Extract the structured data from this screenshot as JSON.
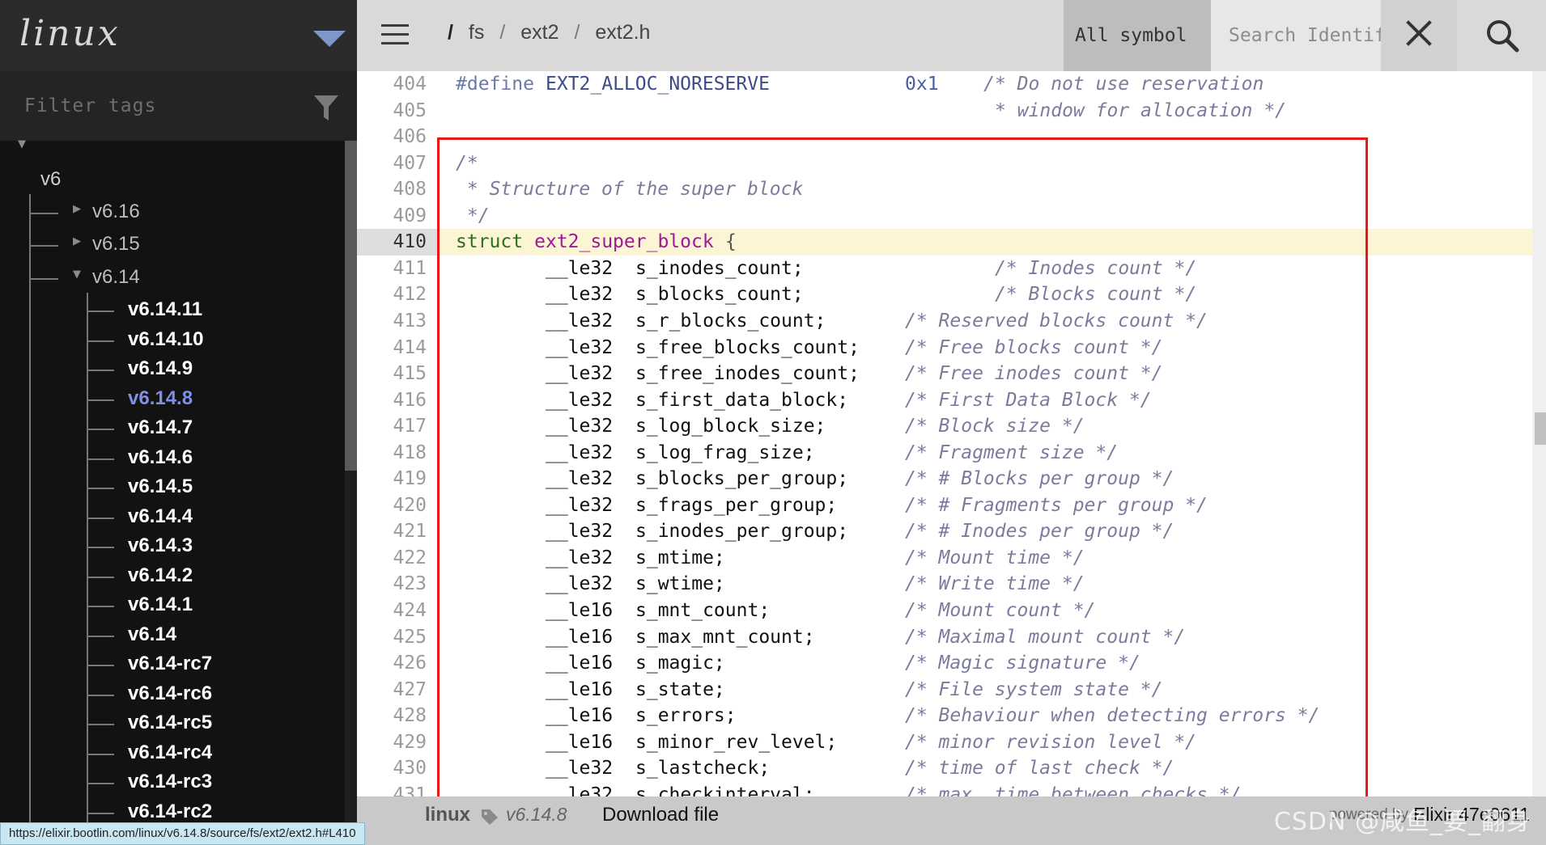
{
  "project": {
    "name": "linux",
    "filter_placeholder": "Filter tags"
  },
  "tree": {
    "root": "v6",
    "branches": [
      {
        "label": "v6.16",
        "expanded": false
      },
      {
        "label": "v6.15",
        "expanded": false
      },
      {
        "label": "v6.14",
        "expanded": true
      }
    ],
    "leaves": [
      "v6.14.11",
      "v6.14.10",
      "v6.14.9",
      "v6.14.8",
      "v6.14.7",
      "v6.14.6",
      "v6.14.5",
      "v6.14.4",
      "v6.14.3",
      "v6.14.2",
      "v6.14.1",
      "v6.14",
      "v6.14-rc7",
      "v6.14-rc6",
      "v6.14-rc5",
      "v6.14-rc4",
      "v6.14-rc3",
      "v6.14-rc2"
    ],
    "active_leaf": "v6.14.8"
  },
  "topbar": {
    "breadcrumb_root": "/",
    "breadcrumb": [
      "fs",
      "ext2",
      "ext2.h"
    ],
    "breadcrumb_sep": "/",
    "symbol_select": "All symbol",
    "search_placeholder": "Search Identifier"
  },
  "code": {
    "highlight_line": "410",
    "lines": [
      {
        "n": "404",
        "parts": [
          {
            "c": "t-pp",
            "col": 0,
            "t": "#define "
          },
          {
            "c": "t-name",
            "col": 8,
            "t": "EXT2_ALLOC_NORESERVE"
          },
          {
            "c": "t-num",
            "col": 40,
            "t": "0x1"
          },
          {
            "c": "t-cmt",
            "col": 47,
            "t": "/* Do not use reservation"
          }
        ]
      },
      {
        "n": "405",
        "parts": [
          {
            "c": "t-cmt",
            "col": 48,
            "t": "* window for allocation */"
          }
        ]
      },
      {
        "n": "406",
        "parts": []
      },
      {
        "n": "407",
        "parts": [
          {
            "c": "t-cmt",
            "col": 0,
            "t": "/*"
          }
        ]
      },
      {
        "n": "408",
        "parts": [
          {
            "c": "t-cmt",
            "col": 1,
            "t": "* Structure of the super block"
          }
        ]
      },
      {
        "n": "409",
        "parts": [
          {
            "c": "t-cmt",
            "col": 1,
            "t": "*/"
          }
        ]
      },
      {
        "n": "410",
        "parts": [
          {
            "c": "t-kw",
            "col": 0,
            "t": "struct "
          },
          {
            "c": "t-sym",
            "col": 7,
            "t": "ext2_super_block"
          },
          {
            "c": "t-punct",
            "col": 24,
            "t": "{"
          }
        ]
      },
      {
        "n": "411",
        "parts": [
          {
            "c": "t-type",
            "col": 8,
            "t": "__le32"
          },
          {
            "c": "t-ident",
            "col": 16,
            "t": "s_inodes_count;"
          },
          {
            "c": "t-cmt",
            "col": 48,
            "t": "/* Inodes count */"
          }
        ]
      },
      {
        "n": "412",
        "parts": [
          {
            "c": "t-type",
            "col": 8,
            "t": "__le32"
          },
          {
            "c": "t-ident",
            "col": 16,
            "t": "s_blocks_count;"
          },
          {
            "c": "t-cmt",
            "col": 48,
            "t": "/* Blocks count */"
          }
        ]
      },
      {
        "n": "413",
        "parts": [
          {
            "c": "t-type",
            "col": 8,
            "t": "__le32"
          },
          {
            "c": "t-ident",
            "col": 16,
            "t": "s_r_blocks_count;"
          },
          {
            "c": "t-cmt",
            "col": 40,
            "t": "/* Reserved blocks count */"
          }
        ]
      },
      {
        "n": "414",
        "parts": [
          {
            "c": "t-type",
            "col": 8,
            "t": "__le32"
          },
          {
            "c": "t-ident",
            "col": 16,
            "t": "s_free_blocks_count;"
          },
          {
            "c": "t-cmt",
            "col": 40,
            "t": "/* Free blocks count */"
          }
        ]
      },
      {
        "n": "415",
        "parts": [
          {
            "c": "t-type",
            "col": 8,
            "t": "__le32"
          },
          {
            "c": "t-ident",
            "col": 16,
            "t": "s_free_inodes_count;"
          },
          {
            "c": "t-cmt",
            "col": 40,
            "t": "/* Free inodes count */"
          }
        ]
      },
      {
        "n": "416",
        "parts": [
          {
            "c": "t-type",
            "col": 8,
            "t": "__le32"
          },
          {
            "c": "t-ident",
            "col": 16,
            "t": "s_first_data_block;"
          },
          {
            "c": "t-cmt",
            "col": 40,
            "t": "/* First Data Block */"
          }
        ]
      },
      {
        "n": "417",
        "parts": [
          {
            "c": "t-type",
            "col": 8,
            "t": "__le32"
          },
          {
            "c": "t-ident",
            "col": 16,
            "t": "s_log_block_size;"
          },
          {
            "c": "t-cmt",
            "col": 40,
            "t": "/* Block size */"
          }
        ]
      },
      {
        "n": "418",
        "parts": [
          {
            "c": "t-type",
            "col": 8,
            "t": "__le32"
          },
          {
            "c": "t-ident",
            "col": 16,
            "t": "s_log_frag_size;"
          },
          {
            "c": "t-cmt",
            "col": 40,
            "t": "/* Fragment size */"
          }
        ]
      },
      {
        "n": "419",
        "parts": [
          {
            "c": "t-type",
            "col": 8,
            "t": "__le32"
          },
          {
            "c": "t-ident",
            "col": 16,
            "t": "s_blocks_per_group;"
          },
          {
            "c": "t-cmt",
            "col": 40,
            "t": "/* # Blocks per group */"
          }
        ]
      },
      {
        "n": "420",
        "parts": [
          {
            "c": "t-type",
            "col": 8,
            "t": "__le32"
          },
          {
            "c": "t-ident",
            "col": 16,
            "t": "s_frags_per_group;"
          },
          {
            "c": "t-cmt",
            "col": 40,
            "t": "/* # Fragments per group */"
          }
        ]
      },
      {
        "n": "421",
        "parts": [
          {
            "c": "t-type",
            "col": 8,
            "t": "__le32"
          },
          {
            "c": "t-ident",
            "col": 16,
            "t": "s_inodes_per_group;"
          },
          {
            "c": "t-cmt",
            "col": 40,
            "t": "/* # Inodes per group */"
          }
        ]
      },
      {
        "n": "422",
        "parts": [
          {
            "c": "t-type",
            "col": 8,
            "t": "__le32"
          },
          {
            "c": "t-ident",
            "col": 16,
            "t": "s_mtime;"
          },
          {
            "c": "t-cmt",
            "col": 40,
            "t": "/* Mount time */"
          }
        ]
      },
      {
        "n": "423",
        "parts": [
          {
            "c": "t-type",
            "col": 8,
            "t": "__le32"
          },
          {
            "c": "t-ident",
            "col": 16,
            "t": "s_wtime;"
          },
          {
            "c": "t-cmt",
            "col": 40,
            "t": "/* Write time */"
          }
        ]
      },
      {
        "n": "424",
        "parts": [
          {
            "c": "t-type",
            "col": 8,
            "t": "__le16"
          },
          {
            "c": "t-ident",
            "col": 16,
            "t": "s_mnt_count;"
          },
          {
            "c": "t-cmt",
            "col": 40,
            "t": "/* Mount count */"
          }
        ]
      },
      {
        "n": "425",
        "parts": [
          {
            "c": "t-type",
            "col": 8,
            "t": "__le16"
          },
          {
            "c": "t-ident",
            "col": 16,
            "t": "s_max_mnt_count;"
          },
          {
            "c": "t-cmt",
            "col": 40,
            "t": "/* Maximal mount count */"
          }
        ]
      },
      {
        "n": "426",
        "parts": [
          {
            "c": "t-type",
            "col": 8,
            "t": "__le16"
          },
          {
            "c": "t-ident",
            "col": 16,
            "t": "s_magic;"
          },
          {
            "c": "t-cmt",
            "col": 40,
            "t": "/* Magic signature */"
          }
        ]
      },
      {
        "n": "427",
        "parts": [
          {
            "c": "t-type",
            "col": 8,
            "t": "__le16"
          },
          {
            "c": "t-ident",
            "col": 16,
            "t": "s_state;"
          },
          {
            "c": "t-cmt",
            "col": 40,
            "t": "/* File system state */"
          }
        ]
      },
      {
        "n": "428",
        "parts": [
          {
            "c": "t-type",
            "col": 8,
            "t": "__le16"
          },
          {
            "c": "t-ident",
            "col": 16,
            "t": "s_errors;"
          },
          {
            "c": "t-cmt",
            "col": 40,
            "t": "/* Behaviour when detecting errors */"
          }
        ]
      },
      {
        "n": "429",
        "parts": [
          {
            "c": "t-type",
            "col": 8,
            "t": "__le16"
          },
          {
            "c": "t-ident",
            "col": 16,
            "t": "s_minor_rev_level;"
          },
          {
            "c": "t-cmt",
            "col": 40,
            "t": "/* minor revision level */"
          }
        ]
      },
      {
        "n": "430",
        "parts": [
          {
            "c": "t-type",
            "col": 8,
            "t": "__le32"
          },
          {
            "c": "t-ident",
            "col": 16,
            "t": "s_lastcheck;"
          },
          {
            "c": "t-cmt",
            "col": 40,
            "t": "/* time of last check */"
          }
        ]
      },
      {
        "n": "431",
        "parts": [
          {
            "c": "t-type",
            "col": 8,
            "t": "__le32"
          },
          {
            "c": "t-ident",
            "col": 16,
            "t": "s_checkinterval;"
          },
          {
            "c": "t-cmt",
            "col": 40,
            "t": "/* max. time between checks */"
          }
        ]
      }
    ]
  },
  "footer": {
    "project": "linux",
    "version": "v6.14.8",
    "download": "Download file",
    "powered_by": "powered by",
    "elixir": "Elixir 47e0611",
    "watermark": "CSDN @咸鱼_要_翻身"
  },
  "status_url": "https://elixir.bootlin.com/linux/v6.14.8/source/fs/ext2/ext2.h#L410",
  "colors": {
    "highlight_box": "#e81818",
    "active_version": "#7f8fe6",
    "highlight_line_bg": "#fcf5d4"
  }
}
